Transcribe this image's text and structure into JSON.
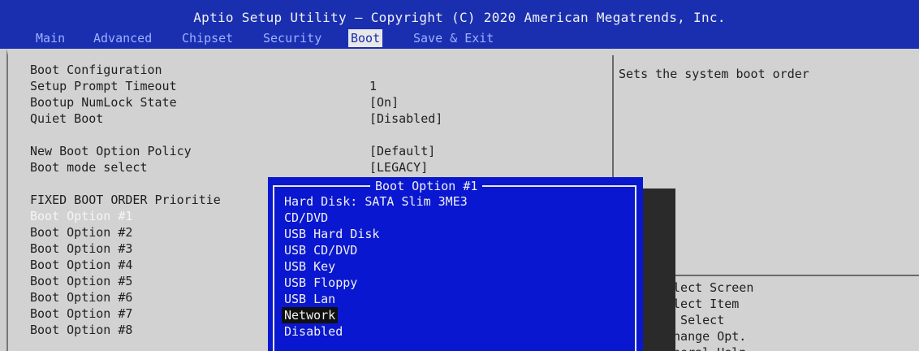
{
  "title": "Aptio Setup Utility – Copyright (C) 2020 American Megatrends, Inc.",
  "menu": {
    "items": [
      {
        "label": "Main",
        "active": false
      },
      {
        "label": "Advanced",
        "active": false
      },
      {
        "label": "Chipset",
        "active": false
      },
      {
        "label": "Security",
        "active": false
      },
      {
        "label": "Boot",
        "active": true
      },
      {
        "label": "Save & Exit",
        "active": false
      }
    ]
  },
  "settings": {
    "section_boot_config": "Boot Configuration",
    "setup_prompt_timeout": {
      "label": "Setup Prompt Timeout",
      "value": "1"
    },
    "bootup_numlock": {
      "label": "Bootup NumLock State",
      "value": "[On]"
    },
    "quiet_boot": {
      "label": "Quiet Boot",
      "value": "[Disabled]"
    },
    "new_boot_option_policy": {
      "label": "New Boot Option Policy",
      "value": "[Default]"
    },
    "boot_mode_select": {
      "label": "Boot mode select",
      "value": "[LEGACY]"
    },
    "section_fixed_order": "FIXED BOOT ORDER Prioritie",
    "boot_options": [
      {
        "label": "Boot Option #1",
        "selected": true
      },
      {
        "label": "Boot Option #2",
        "selected": false
      },
      {
        "label": "Boot Option #3",
        "selected": false
      },
      {
        "label": "Boot Option #4",
        "selected": false
      },
      {
        "label": "Boot Option #5",
        "selected": false
      },
      {
        "label": "Boot Option #6",
        "selected": false
      },
      {
        "label": "Boot Option #7",
        "selected": false
      },
      {
        "label": "Boot Option #8",
        "selected": false
      }
    ]
  },
  "help": {
    "text": "Sets the system boot order",
    "keys": [
      "elect Screen",
      "elect Item",
      ": Select",
      "Change Opt.",
      "eneral Help"
    ]
  },
  "popup": {
    "title": "Boot Option #1",
    "options": [
      {
        "label": "Hard Disk: SATA Slim 3ME3",
        "highlighted": false
      },
      {
        "label": "CD/DVD",
        "highlighted": false
      },
      {
        "label": "USB Hard Disk",
        "highlighted": false
      },
      {
        "label": "USB CD/DVD",
        "highlighted": false
      },
      {
        "label": "USB Key",
        "highlighted": false
      },
      {
        "label": "USB Floppy",
        "highlighted": false
      },
      {
        "label": "USB Lan",
        "highlighted": false
      },
      {
        "label": "Network",
        "highlighted": true
      },
      {
        "label": "Disabled",
        "highlighted": false
      }
    ]
  },
  "colors": {
    "header_bg": "#1a2fb0",
    "content_bg": "#d2d2d2",
    "popup_bg": "#0a17d0",
    "selected_text": "#f5f5f5"
  }
}
